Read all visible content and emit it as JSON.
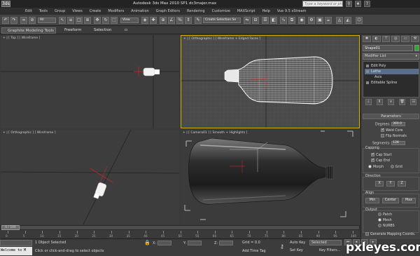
{
  "title_bar": {
    "logo": "3ds",
    "title": "Autodesk 3ds Max 2010 SP1 dc3majer.max",
    "search_placeholder": "Type a keyword or phrase",
    "icons": [
      "binoculars-icon",
      "star-icon",
      "help-icon"
    ]
  },
  "menu": [
    "Edit",
    "Tools",
    "Group",
    "Views",
    "Create",
    "Modifiers",
    "Animation",
    "Graph Editors",
    "Rendering",
    "Customize",
    "MAXScript",
    "Help",
    "Vue 9.5 xStream"
  ],
  "toolbar": {
    "filter_select": "All",
    "coord_select": "View",
    "selection_set": "Create Selection Se"
  },
  "ribbon": {
    "tabs": [
      "Graphite Modeling Tools",
      "Freeform",
      "Selection"
    ]
  },
  "viewports": {
    "top_label": "+ | [ Top ] [ Wireframe ]",
    "front_label": "+ | [ Orthographic ] [ Wireframe + Edged Faces ]",
    "left_label": "+ | [ Orthographic ] [ Wireframe ]",
    "persp_label": "+ | [ Camera01 ] [ Smooth + Highlights ]"
  },
  "command_panel": {
    "shape_name": "Shape01",
    "modifier_list": "Modifier List",
    "stack": [
      {
        "label": "Edit Poly",
        "selected": false
      },
      {
        "label": "Lathe",
        "selected": true
      },
      {
        "label": "Axis",
        "selected": false
      },
      {
        "label": "Editable Spline",
        "selected": false
      }
    ],
    "parameters": {
      "header": "Parameters",
      "degrees_label": "Degrees:",
      "degrees_value": "360.0",
      "weld_core": "Weld Core",
      "flip_normals": "Flip Normals",
      "segments_label": "Segments:",
      "segments_value": "128",
      "capping_label": "Capping",
      "cap_start": "Cap Start",
      "cap_end": "Cap End",
      "morph": "Morph",
      "grid": "Grid",
      "direction_label": "Direction",
      "dir_x": "X",
      "dir_y": "Y",
      "dir_z": "Z",
      "align_label": "Align",
      "align_min": "Min",
      "align_center": "Center",
      "align_max": "Max",
      "output_label": "Output",
      "out_patch": "Patch",
      "out_mesh": "Mesh",
      "out_nurbs": "NURBS",
      "gen_mapping": "Generate Mapping Coords."
    }
  },
  "timeline": {
    "handle": "0 / 100",
    "ticks": [
      "0",
      "5",
      "10",
      "15",
      "20",
      "25",
      "30",
      "35",
      "40",
      "45",
      "50",
      "55",
      "60",
      "65",
      "70",
      "75",
      "80",
      "85",
      "90",
      "95",
      "100"
    ]
  },
  "status": {
    "maxscript": "Welcome to M",
    "selected": "1 Object Selected",
    "prompt": "Click or click-and-drag to select objects",
    "x_label": "X:",
    "y_label": "Y:",
    "z_label": "Z:",
    "grid": "Grid = 0.0 ",
    "add_time_tag": "Add Time Tag",
    "auto_key": "Auto Key",
    "set_key": "Set Key",
    "selected_dropdown": "Selected",
    "key_filters": "Key Filters..."
  },
  "watermark": "pxleyes.com"
}
